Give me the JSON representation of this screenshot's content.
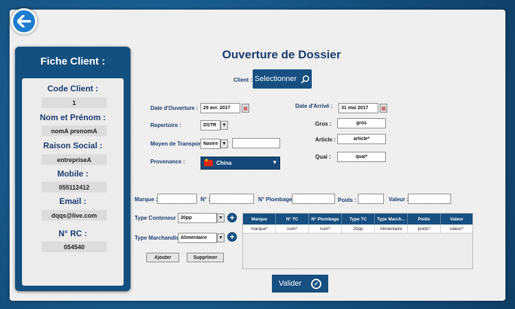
{
  "client_card": {
    "title": "Fiche Client :",
    "fields": [
      {
        "label": "Code Client :",
        "value": "1"
      },
      {
        "label": "Nom et Prénom :",
        "value": "nomA prenomA"
      },
      {
        "label": "Raison Social :",
        "value": "entrepriseA"
      },
      {
        "label": "Mobile :",
        "value": "055112412"
      },
      {
        "label": "Email :",
        "value": "dqqs@live.com"
      },
      {
        "label": "N° RC :",
        "value": "054540"
      }
    ]
  },
  "form": {
    "title": "Ouverture de Dossier",
    "client_label": "Client :",
    "select_button": "Selectionner",
    "date_ouverture_label": "Date d'Ouverture :",
    "date_ouverture_value": "29 avr. 2017",
    "date_arrive_label": "Date d'Arrivé :",
    "date_arrive_value": "31 mai 2017",
    "repertoire_label": "Repertoire :",
    "repertoire_value": "DSTR",
    "gros_label": "Gros :",
    "gros_value": "gros",
    "transport_label": "Moyen de Transport :",
    "transport_value": "Navire",
    "transport_extra_value": "",
    "article_label": "Article :",
    "article_value": "article*",
    "quai_label": "Quai :",
    "quai_value": "quai*",
    "provenance_label": "Provenance :",
    "provenance_value": "China",
    "marque_label": "Marque :",
    "marque_value": "",
    "numero_label": "N° :",
    "numero_value": "",
    "plombage_label": "N° Plombage :",
    "plombage_value": "",
    "poids_label": "Poids :",
    "poids_value": "",
    "valeur_label": "Valeur :",
    "valeur_value": "",
    "type_conteneur_label": "Type Conteneur :",
    "type_conteneur_value": "20pp",
    "type_marchandise_label": "Type Marchandise:",
    "type_marchandise_value": "Alimentaire",
    "ajouter_button": "Ajouter",
    "supprimer_button": "Supprimer",
    "valider_button": "Valider"
  },
  "table": {
    "headers": [
      "Marque",
      "N° TC",
      "N° Plombage",
      "Type TC",
      "Type March...",
      "Poids",
      "Valeur"
    ],
    "rows": [
      [
        "marque*",
        "num*",
        "num*",
        "20pp",
        "Alimentaire",
        "poids*",
        "valeur*"
      ]
    ]
  },
  "colors": {
    "brand_blue": "#164f80",
    "label_blue": "#1b3a70",
    "flag_red": "#de2910"
  }
}
